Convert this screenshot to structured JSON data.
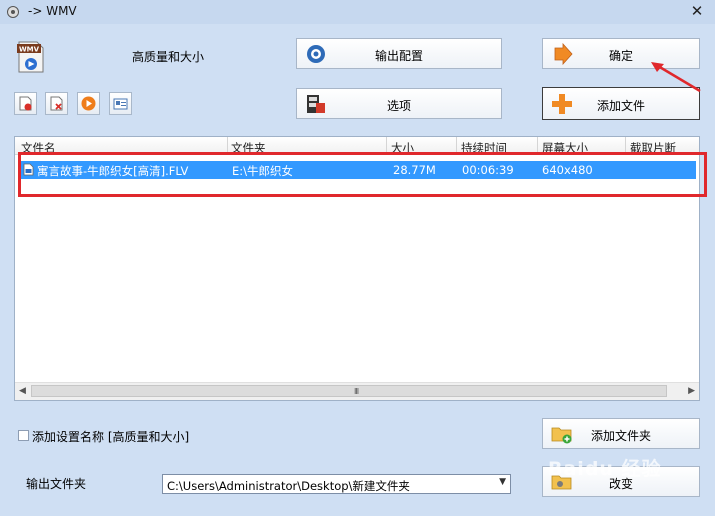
{
  "window": {
    "title": "-> WMV"
  },
  "profile": {
    "label": "高质量和大小",
    "icon_name": "wmv-file-icon",
    "icon_text": "WMV"
  },
  "buttons": {
    "output_config": "输出配置",
    "ok": "确定",
    "options": "选项",
    "add_file": "添加文件",
    "add_folder": "添加文件夹",
    "change": "改变"
  },
  "toolbar": [
    {
      "name": "remove-item-icon"
    },
    {
      "name": "clear-list-icon"
    },
    {
      "name": "play-icon"
    },
    {
      "name": "media-info-icon"
    }
  ],
  "table": {
    "columns": [
      "文件名",
      "文件夹",
      "大小",
      "持续时间",
      "屏幕大小",
      "截取片断"
    ],
    "rows": [
      {
        "filename": "寓言故事-牛郎织女[高清].FLV",
        "folder": "E:\\牛郎织女",
        "size": "28.77M",
        "duration": "00:06:39",
        "screen_size": "640x480",
        "clip": ""
      }
    ]
  },
  "add_setting_name": {
    "label": "添加设置名称 [高质量和大小]",
    "checked": false
  },
  "output_folder": {
    "label": "输出文件夹",
    "value": "C:\\Users\\Administrator\\Desktop\\新建文件夹"
  },
  "scrollbar": {
    "grip": "III"
  },
  "watermark": "Baidu 经验",
  "colors": {
    "selection": "#3399ff",
    "annotation": "#e0282c",
    "background": "#cfdff3"
  }
}
